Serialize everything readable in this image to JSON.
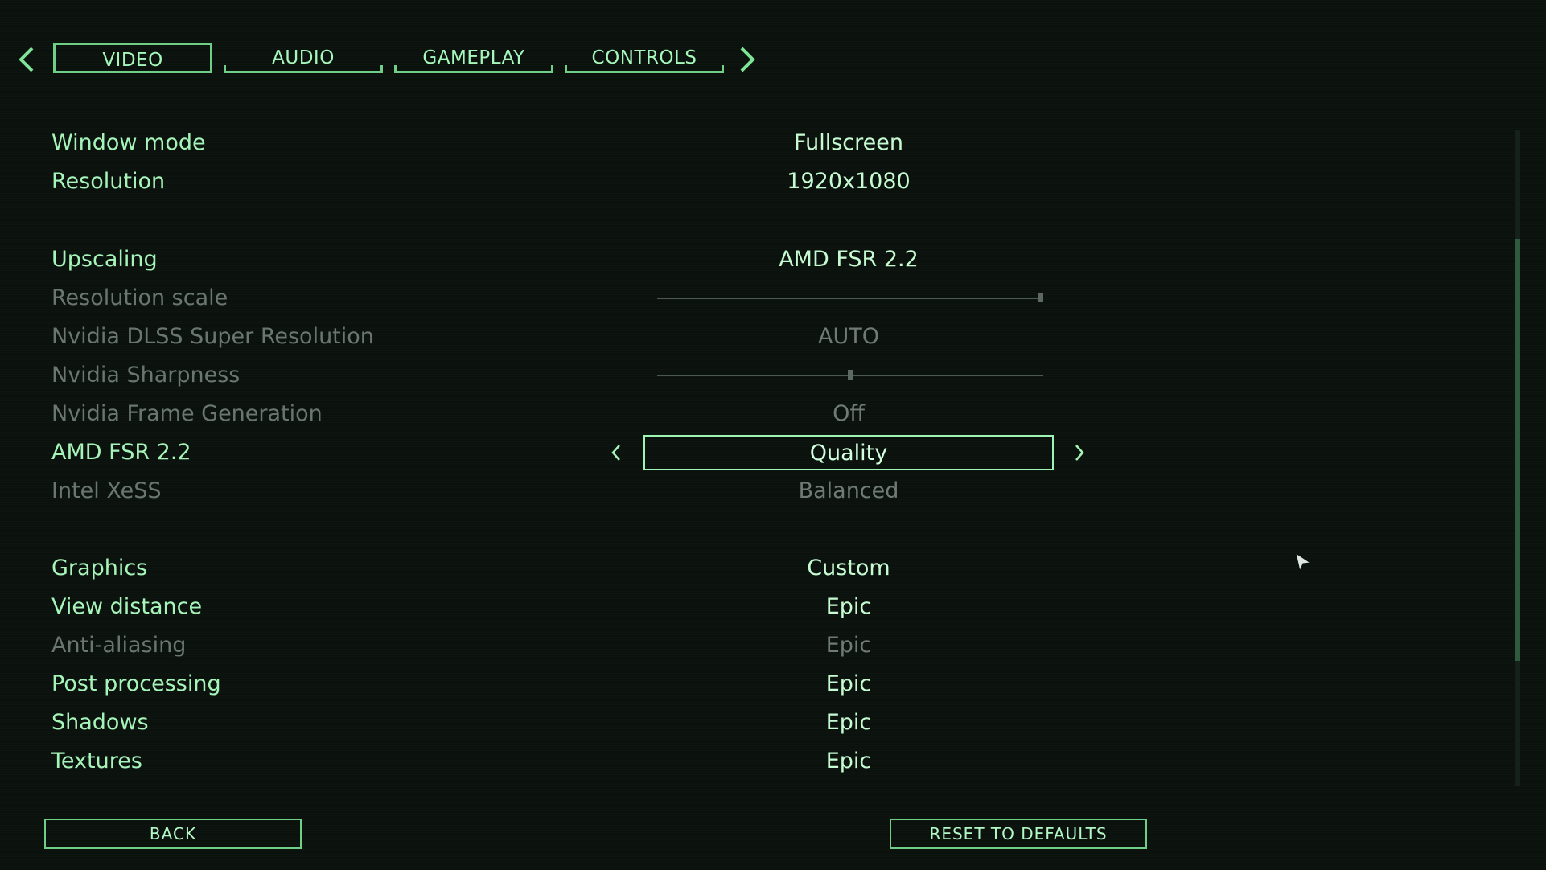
{
  "tabs": {
    "items": [
      {
        "label": "VIDEO",
        "active": true
      },
      {
        "label": "AUDIO",
        "active": false
      },
      {
        "label": "GAMEPLAY",
        "active": false
      },
      {
        "label": "CONTROLS",
        "active": false
      }
    ],
    "prev_icon": "chevron-left-icon",
    "next_icon": "chevron-right-icon"
  },
  "settings": {
    "window_mode": {
      "label": "Window mode",
      "value": "Fullscreen"
    },
    "resolution": {
      "label": "Resolution",
      "value": "1920x1080"
    },
    "upscaling": {
      "label": "Upscaling",
      "value": "AMD FSR 2.2"
    },
    "resolution_scale": {
      "label": "Resolution scale",
      "level": 1.0,
      "enabled": false
    },
    "dlss": {
      "label": "Nvidia DLSS Super Resolution",
      "value": "AUTO",
      "enabled": false
    },
    "nvidia_sharpness": {
      "label": "Nvidia Sharpness",
      "level": 0.5,
      "enabled": false
    },
    "frame_generation": {
      "label": "Nvidia Frame Generation",
      "value": "Off",
      "enabled": false
    },
    "amd_fsr": {
      "label": "AMD FSR 2.2",
      "value": "Quality",
      "selected": true
    },
    "intel_xess": {
      "label": "Intel XeSS",
      "value": "Balanced",
      "enabled": false
    },
    "graphics": {
      "label": "Graphics",
      "value": "Custom"
    },
    "view_distance": {
      "label": "View distance",
      "value": "Epic"
    },
    "anti_aliasing": {
      "label": "Anti-aliasing",
      "value": "Epic",
      "enabled": false
    },
    "post_processing": {
      "label": "Post processing",
      "value": "Epic"
    },
    "shadows": {
      "label": "Shadows",
      "value": "Epic"
    },
    "textures": {
      "label": "Textures",
      "value": "Epic"
    }
  },
  "buttons": {
    "back": "BACK",
    "reset": "RESET TO DEFAULTS"
  },
  "colors": {
    "accent": "#6fcf87",
    "text": "#a6f4b9",
    "disabled": "#6a776f",
    "background": "#0b120e"
  }
}
